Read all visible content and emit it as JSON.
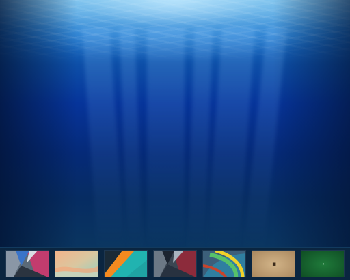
{
  "desktop": {
    "wallpaper_icon": "underwater-light-rays-wallpaper"
  },
  "wallpaper_picker": {
    "thumbnails": [
      {
        "icon": "geometric-pink-gray-wallpaper"
      },
      {
        "icon": "pastel-gradient-wallpaper"
      },
      {
        "icon": "orange-teal-diagonal-wallpaper"
      },
      {
        "icon": "geometric-dark-crimson-wallpaper"
      },
      {
        "icon": "green-yellow-swirl-wallpaper"
      },
      {
        "icon": "tan-paper-wallpaper",
        "mark": "▪"
      },
      {
        "icon": "green-field-wallpaper",
        "mark": "›"
      }
    ]
  },
  "colors": {
    "dock_background": "#0a2540",
    "water_top": "#4aa3de",
    "water_deep": "#06349a"
  }
}
